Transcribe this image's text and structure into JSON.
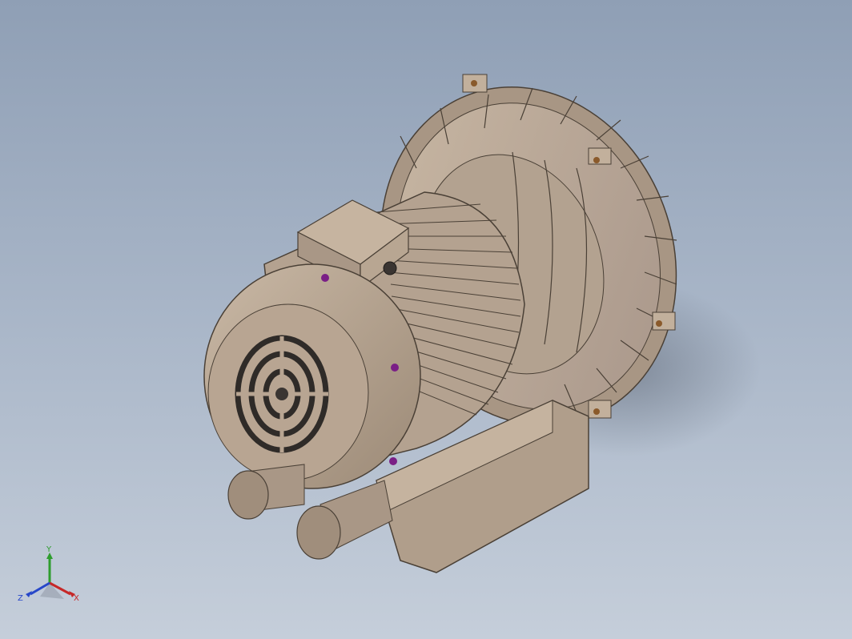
{
  "viewport": {
    "background_top": "#8f9fb5",
    "background_bottom": "#c5ceda"
  },
  "model": {
    "name": "regenerative-blower",
    "body_color": "#b7a592",
    "shadow_color": "#8a7a69",
    "bolt_color": "#7a1f86",
    "nut_color": "#8a5a2b"
  },
  "triad": {
    "x_label": "X",
    "y_label": "Y",
    "z_label": "Z",
    "x_color": "#c62828",
    "y_color": "#2e9d2e",
    "z_color": "#2747c9"
  }
}
